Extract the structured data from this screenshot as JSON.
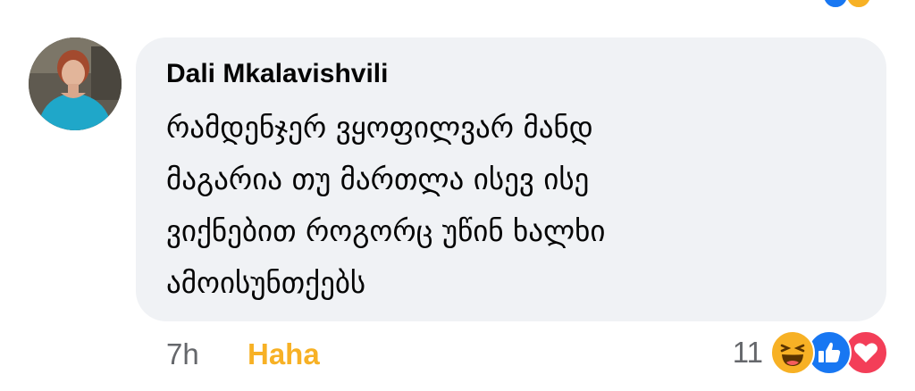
{
  "comment": {
    "author": "Dali Mkalavishvili",
    "text_lines": [
      "რამდენჯერ ვყოფილვარ მანდ",
      "მაგარია თუ მართლა ისევ ისე",
      "ვიქნებით როგორც უწინ ხალხი",
      "ამოისუნთქებს"
    ],
    "timestamp": "7h",
    "reaction_action": "Haha",
    "reaction_count": "11",
    "reaction_icons": [
      "haha-emoji",
      "like-emoji",
      "love-emoji"
    ]
  },
  "colors": {
    "bubble": "#f0f2f5",
    "meta_text": "#65676b",
    "haha": "#f7b125",
    "like": "#1877f2",
    "love": "#f33e58"
  }
}
